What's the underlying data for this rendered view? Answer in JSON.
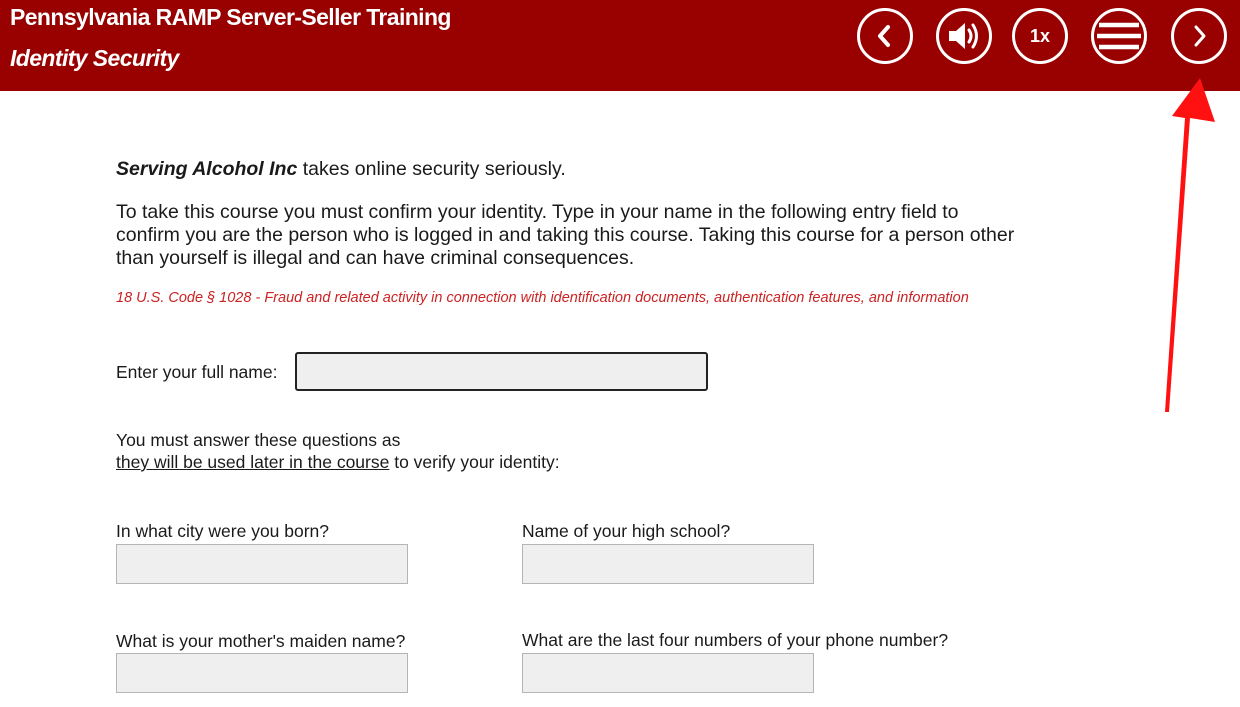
{
  "header": {
    "course_title": "Pennsylvania RAMP Server-Seller Training",
    "module_title": "Identity Security",
    "bg_color": "#990000",
    "controls": {
      "back_icon": "chevron-left-icon",
      "audio_icon": "speaker-icon",
      "speed_label": "1x",
      "menu_icon": "menu-icon",
      "next_icon": "chevron-right-icon"
    }
  },
  "intro": {
    "company_name": "Serving Alcohol Inc",
    "company_suffix": " takes online security seriously.",
    "instructions_line1": "To take this course you must confirm your identity. Type in your name in the following entry field to",
    "instructions_line2": "confirm you are the person who is logged in and taking this course. Taking this course for a person other",
    "instructions_line3": "than yourself is illegal and can have criminal consequences.",
    "legal_note": "18 U.S. Code § 1028 - Fraud and related activity in connection with identification documents, authentication features, and information"
  },
  "form": {
    "full_name_label": "Enter your full name:",
    "full_name_value": "",
    "questions_intro_line1": "You must answer these questions as",
    "questions_link": "they will be used later in the course",
    "questions_intro_tail": " to verify your identity:",
    "questions": {
      "city": {
        "label": "In what city were you born?",
        "value": ""
      },
      "school": {
        "label": "Name of your high school?",
        "value": ""
      },
      "maiden": {
        "label": "What is your mother's maiden name?",
        "value": ""
      },
      "phone": {
        "label": "What are the last four numbers of your phone number?",
        "value": ""
      }
    }
  },
  "annotation": {
    "arrow_color": "#ff1111",
    "points_to": "next-button"
  }
}
